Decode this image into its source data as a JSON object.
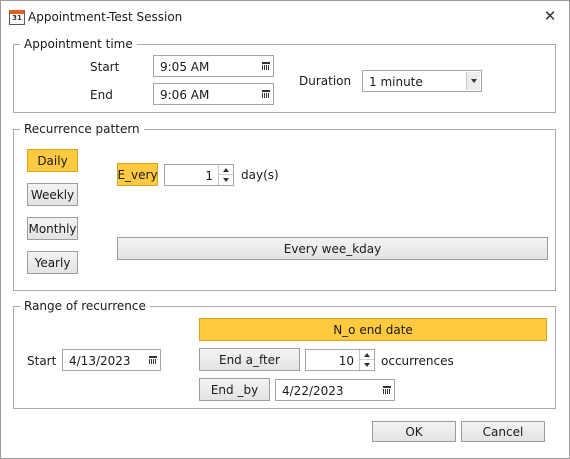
{
  "window": {
    "title": "Appointment-Test Session",
    "icon": "calendar-app-icon",
    "icon_text": "31",
    "close_glyph": "✕"
  },
  "appointment_time": {
    "legend": "Appointment time",
    "start_label": "Start",
    "start_value": "9:05 AM",
    "end_label": "End",
    "end_value": "9:06 AM",
    "duration_label": "Duration",
    "duration_value": "1 minute"
  },
  "recurrence_pattern": {
    "legend": "Recurrence pattern",
    "frequencies": [
      {
        "label": "Daily",
        "selected": true
      },
      {
        "label": "Weekly",
        "selected": false
      },
      {
        "label": "Monthly",
        "selected": false
      },
      {
        "label": "Yearly",
        "selected": false
      }
    ],
    "every_button": "E_very",
    "every_value": "1",
    "every_unit": "day(s)",
    "every_weekday_button": "Every wee_kday"
  },
  "range": {
    "legend": "Range of recurrence",
    "start_label": "Start",
    "start_value": "4/13/2023",
    "no_end_button": "N_o end date",
    "end_after_button": "End a_fter",
    "occurrences_value": "10",
    "occurrences_label": "occurrences",
    "end_by_button": "End _by",
    "end_by_value": "4/22/2023"
  },
  "footer": {
    "ok": "OK",
    "cancel": "Cancel"
  },
  "colors": {
    "active": "#ffc940",
    "border": "#aaaaaa"
  }
}
